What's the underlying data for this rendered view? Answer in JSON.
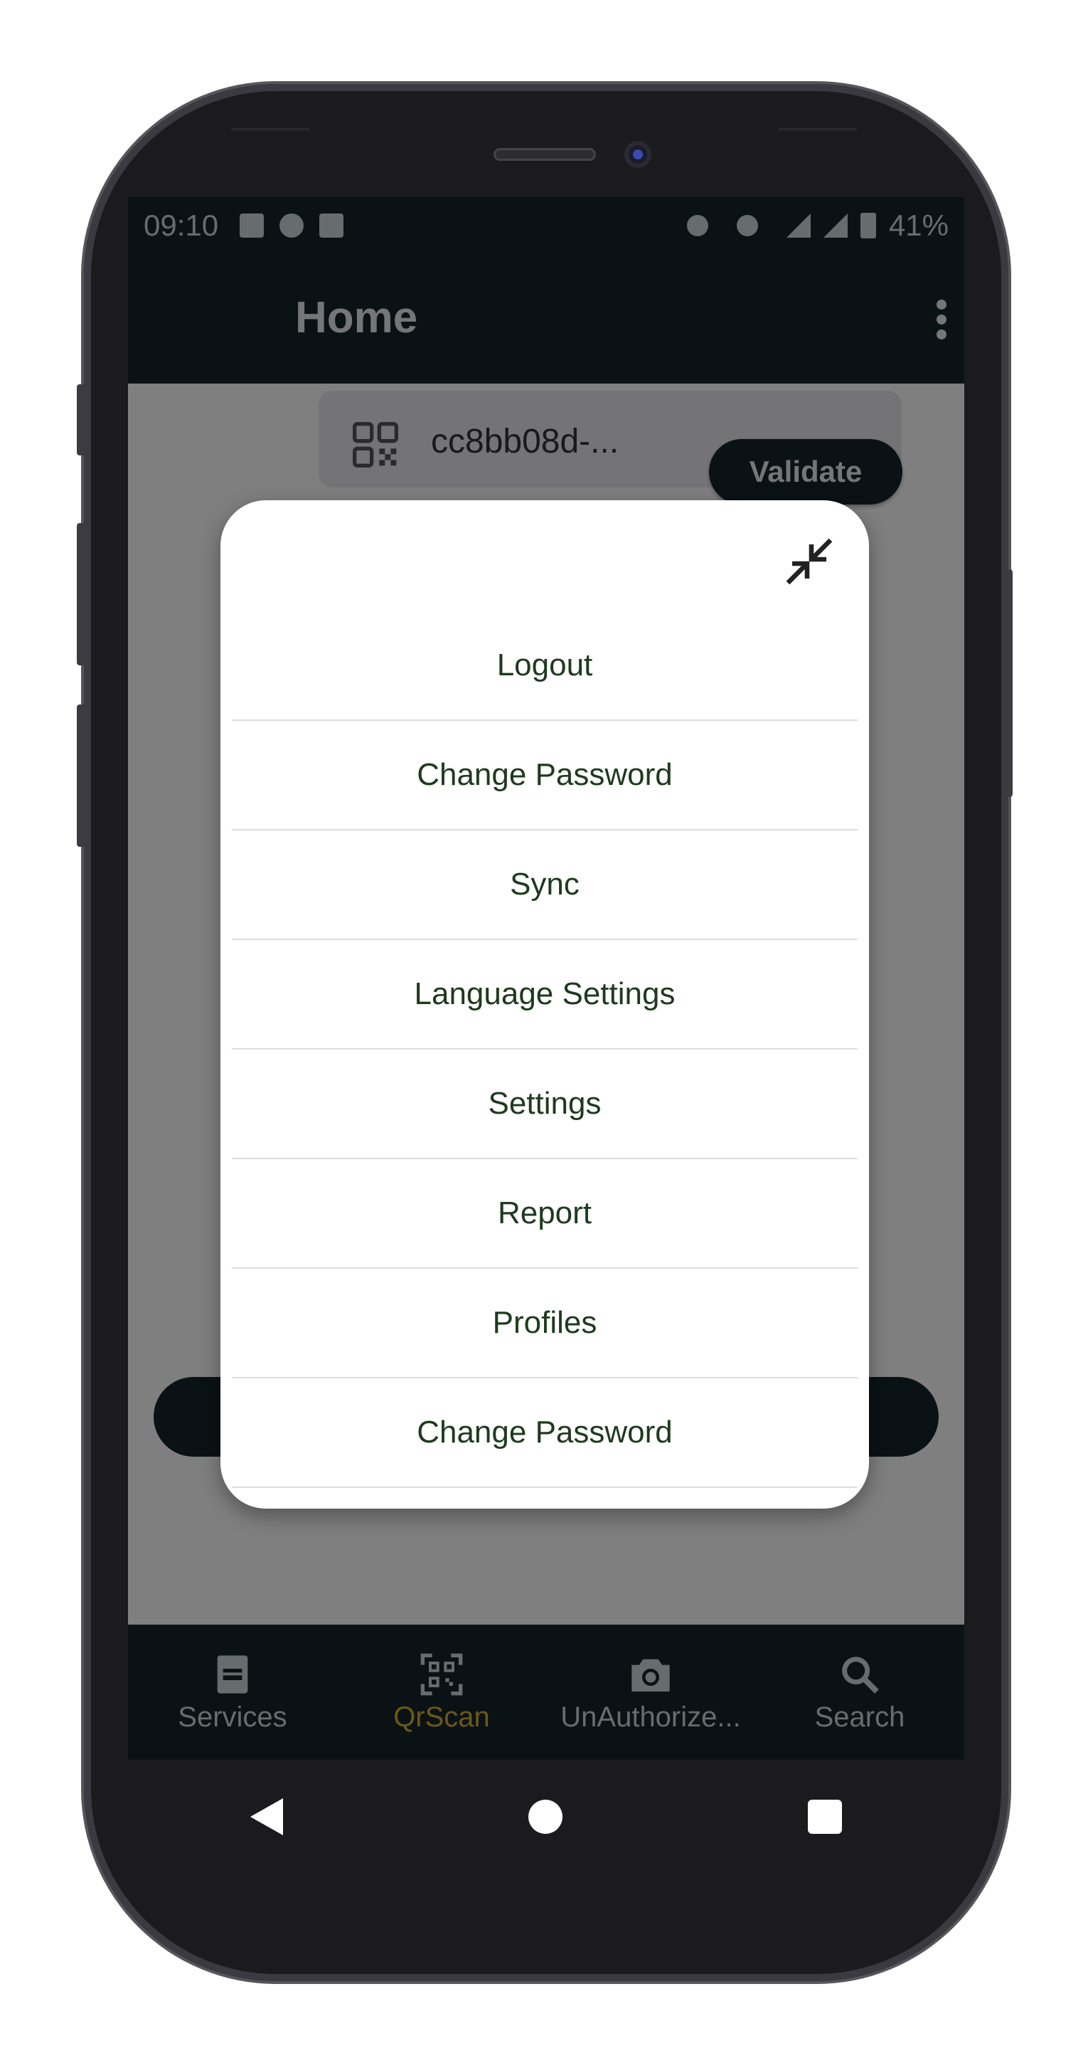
{
  "status_bar": {
    "time": "09:10",
    "battery": "41%"
  },
  "app_bar": {
    "title": "Home"
  },
  "scan": {
    "value": "cc8bb08d-...",
    "validate_label": "Validate"
  },
  "menu": {
    "items": [
      "Logout",
      "Change Password",
      "Sync",
      "Language Settings",
      "Settings",
      "Report",
      "Profiles",
      "Change Password"
    ]
  },
  "bottom_nav": {
    "items": [
      {
        "label": "Services",
        "icon": "services-icon"
      },
      {
        "label": "QrScan",
        "icon": "qr-scan-icon",
        "active": true
      },
      {
        "label": "UnAuthorize...",
        "icon": "camera-icon"
      },
      {
        "label": "Search",
        "icon": "search-icon"
      }
    ]
  },
  "colors": {
    "primary": "#14242b",
    "accent": "#d4b02c",
    "menu_text": "#1f3a1f"
  }
}
